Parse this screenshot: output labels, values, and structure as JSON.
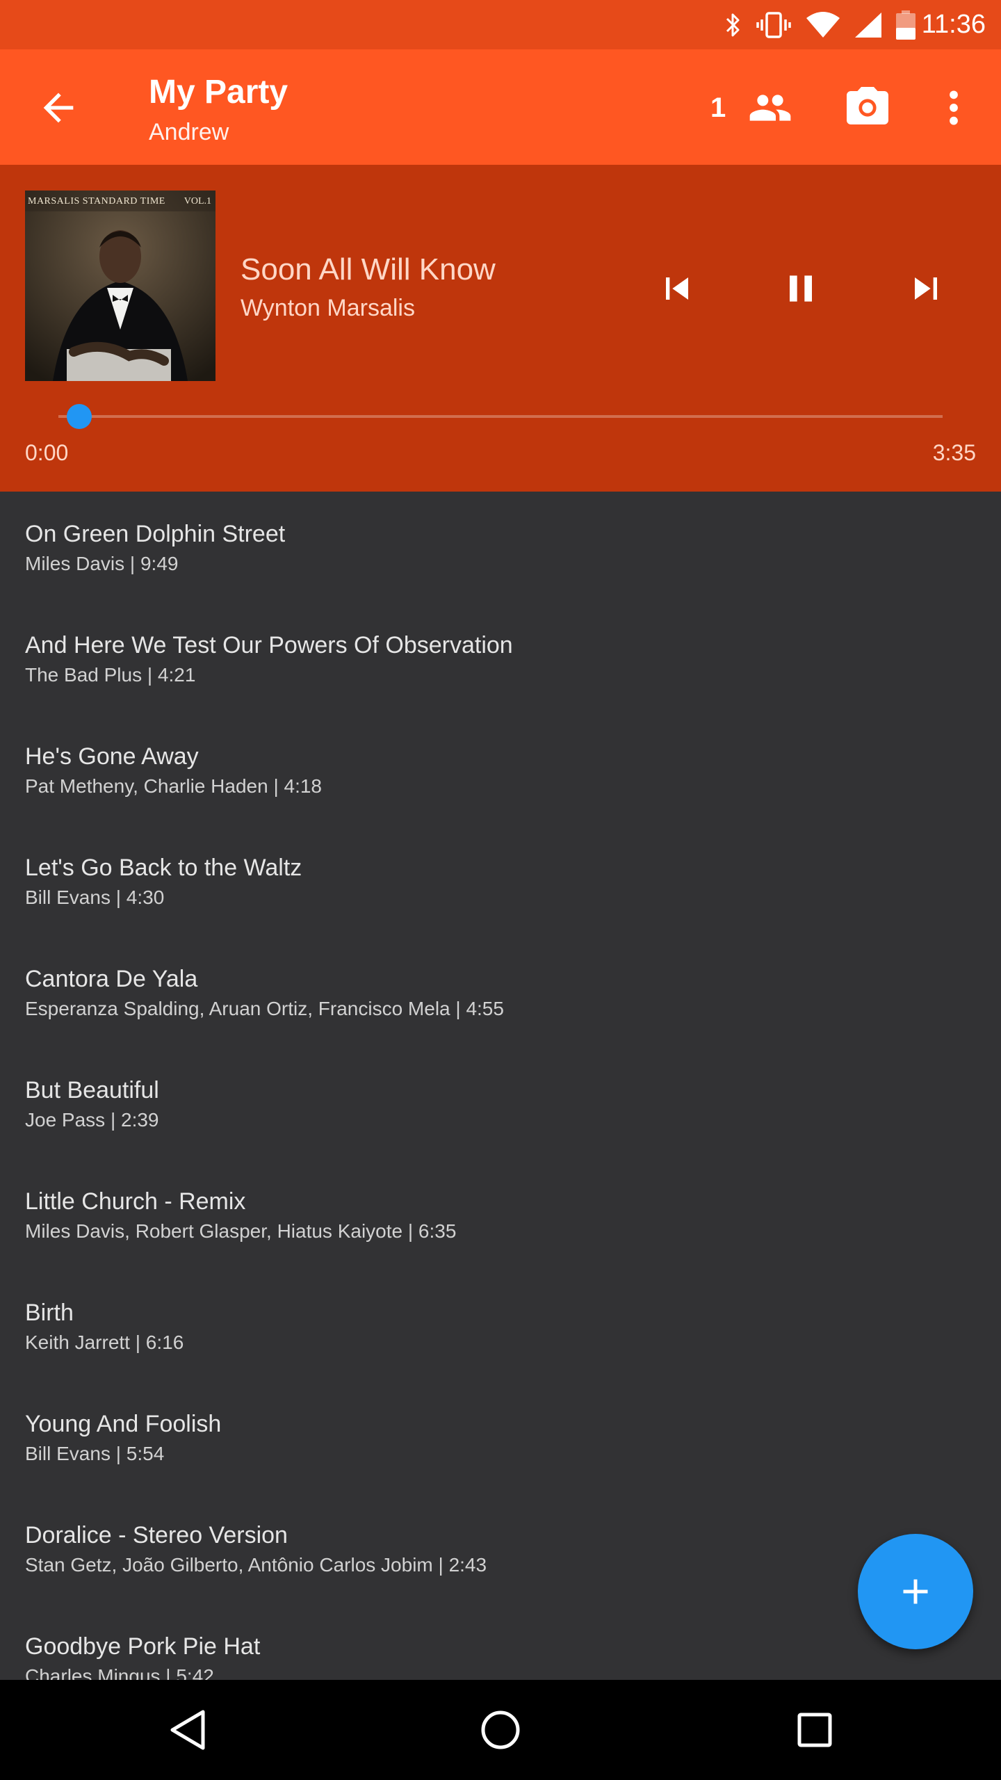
{
  "status_bar": {
    "time": "11:36",
    "icons": [
      "bluetooth-icon",
      "vibrate-icon",
      "wifi-icon",
      "cell-signal-icon",
      "battery-icon"
    ]
  },
  "app_bar": {
    "title": "My Party",
    "subtitle": "Andrew",
    "guest_count": "1",
    "icons": [
      "back-arrow-icon",
      "people-icon",
      "camera-icon",
      "more-vert-icon"
    ]
  },
  "now_playing": {
    "album_cover_text": "MARSALIS STANDARD TIME",
    "album_cover_volume": "VOL.1",
    "title": "Soon All Will Know",
    "artist": "Wynton Marsalis",
    "elapsed": "0:00",
    "duration": "3:35",
    "progress": 0.0,
    "controls": [
      "skip-previous-icon",
      "pause-icon",
      "skip-next-icon"
    ]
  },
  "queue": [
    {
      "title": "On Green Dolphin Street",
      "meta": "Miles Davis | 9:49"
    },
    {
      "title": "And Here We Test Our Powers Of Observation",
      "meta": "The Bad Plus | 4:21"
    },
    {
      "title": "He's Gone Away",
      "meta": "Pat Metheny, Charlie Haden | 4:18"
    },
    {
      "title": "Let's Go Back to the Waltz",
      "meta": "Bill Evans | 4:30"
    },
    {
      "title": "Cantora De Yala",
      "meta": "Esperanza Spalding, Aruan Ortiz, Francisco Mela | 4:55"
    },
    {
      "title": "But Beautiful",
      "meta": "Joe Pass | 2:39"
    },
    {
      "title": "Little Church - Remix",
      "meta": "Miles Davis, Robert Glasper, Hiatus Kaiyote | 6:35"
    },
    {
      "title": "Birth",
      "meta": "Keith Jarrett | 6:16"
    },
    {
      "title": "Young And Foolish",
      "meta": "Bill Evans | 5:54"
    },
    {
      "title": "Doralice - Stereo Version",
      "meta": "Stan Getz, João Gilberto, Antônio Carlos Jobim | 2:43"
    },
    {
      "title": "Goodbye Pork Pie Hat",
      "meta": "Charles Mingus | 5:42"
    }
  ],
  "fab": {
    "icon": "add-icon"
  },
  "nav_bar": {
    "icons": [
      "nav-back-icon",
      "nav-home-icon",
      "nav-recents-icon"
    ]
  },
  "colors": {
    "status_bar": "#e64a19",
    "app_bar": "#ff5722",
    "player": "#bf360c",
    "background": "#323234",
    "accent": "#2196f3"
  }
}
